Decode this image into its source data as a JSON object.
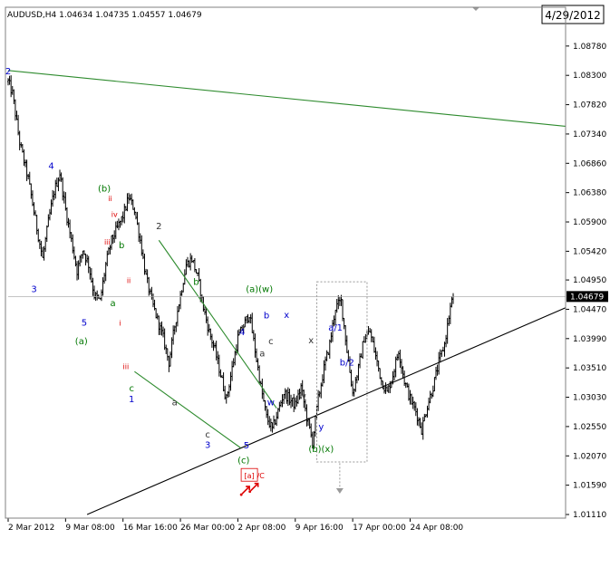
{
  "header": {
    "symbol_info": "AUDUSD,H4  1.04634 1.04735 1.04557 1.04679",
    "date_badge": "4/29/2012",
    "price_tag": "1.04679"
  },
  "colors": {
    "background": "#ffffff",
    "candles": "#000000",
    "frame": "#808080",
    "price_tag_bg": "#000000",
    "price_tag_text": "#ffffff",
    "green_lines": "#2e8b2e",
    "black_line": "#000000",
    "label_blue": "#0000cc",
    "label_green": "#007700",
    "label_red": "#dd0000",
    "label_dark": "#333333",
    "box_border": "#999999"
  },
  "chart_data": {
    "type": "candlestick",
    "title": "AUDUSD,H4",
    "ohlc_last": {
      "open": 1.04634,
      "high": 1.04735,
      "low": 1.04557,
      "close": 1.04679
    },
    "ylim": [
      1.0111,
      1.09
    ],
    "y_ticks": [
      "1.08780",
      "1.08300",
      "1.07820",
      "1.07340",
      "1.06860",
      "1.06380",
      "1.05900",
      "1.05420",
      "1.04950",
      "1.04470",
      "1.03990",
      "1.03510",
      "1.03030",
      "1.02550",
      "1.02070",
      "1.01590",
      "1.01110"
    ],
    "x_ticks": [
      "2 Mar 2012",
      "9 Mar 08:00",
      "16 Mar 16:00",
      "26 Mar 00:00",
      "2 Apr 08:00",
      "9 Apr 16:00",
      "17 Apr 00:00",
      "24 Apr 08:00"
    ],
    "x_tick_index": [
      0,
      40,
      80,
      120,
      160,
      200,
      240,
      280
    ],
    "bar_count": 310,
    "close_anchors": [
      [
        0,
        1.082
      ],
      [
        3,
        1.08
      ],
      [
        8,
        1.072
      ],
      [
        14,
        1.066
      ],
      [
        20,
        1.058
      ],
      [
        24,
        1.053
      ],
      [
        28,
        1.059
      ],
      [
        32,
        1.064
      ],
      [
        36,
        1.067
      ],
      [
        40,
        1.061
      ],
      [
        44,
        1.056
      ],
      [
        48,
        1.051
      ],
      [
        52,
        1.0545
      ],
      [
        56,
        1.052
      ],
      [
        60,
        1.047
      ],
      [
        64,
        1.046
      ],
      [
        68,
        1.052
      ],
      [
        72,
        1.056
      ],
      [
        76,
        1.058
      ],
      [
        80,
        1.06
      ],
      [
        84,
        1.063
      ],
      [
        88,
        1.061
      ],
      [
        92,
        1.056
      ],
      [
        96,
        1.05
      ],
      [
        100,
        1.046
      ],
      [
        104,
        1.043
      ],
      [
        108,
        1.04
      ],
      [
        112,
        1.036
      ],
      [
        116,
        1.042
      ],
      [
        120,
        1.047
      ],
      [
        124,
        1.052
      ],
      [
        128,
        1.053
      ],
      [
        132,
        1.05
      ],
      [
        136,
        1.045
      ],
      [
        140,
        1.041
      ],
      [
        144,
        1.038
      ],
      [
        148,
        1.034
      ],
      [
        152,
        1.03
      ],
      [
        156,
        1.035
      ],
      [
        160,
        1.04
      ],
      [
        164,
        1.042
      ],
      [
        168,
        1.044
      ],
      [
        172,
        1.038
      ],
      [
        176,
        1.032
      ],
      [
        180,
        1.027
      ],
      [
        184,
        1.025
      ],
      [
        188,
        1.028
      ],
      [
        192,
        1.031
      ],
      [
        196,
        1.03
      ],
      [
        200,
        1.029
      ],
      [
        204,
        1.032
      ],
      [
        208,
        1.027
      ],
      [
        212,
        1.023
      ],
      [
        216,
        1.03
      ],
      [
        220,
        1.035
      ],
      [
        224,
        1.039
      ],
      [
        228,
        1.045
      ],
      [
        232,
        1.046
      ],
      [
        236,
        1.038
      ],
      [
        240,
        1.031
      ],
      [
        244,
        1.035
      ],
      [
        248,
        1.04
      ],
      [
        252,
        1.041
      ],
      [
        256,
        1.037
      ],
      [
        260,
        1.033
      ],
      [
        264,
        1.031
      ],
      [
        268,
        1.034
      ],
      [
        272,
        1.038
      ],
      [
        276,
        1.033
      ],
      [
        280,
        1.03
      ],
      [
        284,
        1.028
      ],
      [
        288,
        1.025
      ],
      [
        292,
        1.029
      ],
      [
        296,
        1.032
      ],
      [
        300,
        1.036
      ],
      [
        304,
        1.039
      ],
      [
        308,
        1.045
      ],
      [
        310,
        1.0468
      ]
    ],
    "trendlines": [
      {
        "name": "upper-green-line",
        "color": "green",
        "from": [
          0,
          1.0838
        ],
        "to": [
          310,
          1.0765
        ]
      },
      {
        "name": "lower-black-line",
        "color": "black",
        "from": [
          55,
          1.0111
        ],
        "to": [
          310,
          1.037
        ]
      },
      {
        "name": "channel-upper-line",
        "color": "green",
        "from": [
          105,
          1.056
        ],
        "to": [
          187,
          1.0285
        ]
      },
      {
        "name": "channel-lower-line",
        "color": "green",
        "from": [
          88,
          1.0345
        ],
        "to": [
          162,
          1.022
        ]
      },
      {
        "name": "current-price-line",
        "color": "gray",
        "from": [
          0,
          1.04679
        ],
        "to": [
          310,
          1.04679
        ]
      }
    ],
    "box": {
      "from": [
        215,
        1.0492
      ],
      "to": [
        250,
        1.0197
      ]
    },
    "projection_arrow": {
      "from": [
        231,
        1.0195
      ],
      "to": [
        231,
        1.0148
      ]
    },
    "annotations": [
      {
        "text": "2",
        "at": [
          0,
          1.0832
        ],
        "color": "blue"
      },
      {
        "text": "4",
        "at": [
          30,
          1.0677
        ],
        "color": "blue"
      },
      {
        "text": "3",
        "at": [
          18,
          1.0475
        ],
        "color": "blue"
      },
      {
        "text": "5",
        "at": [
          53,
          1.042
        ],
        "color": "blue"
      },
      {
        "text": "(a)",
        "at": [
          51,
          1.039
        ],
        "color": "green"
      },
      {
        "text": "(b)",
        "at": [
          67,
          1.064
        ],
        "color": "green"
      },
      {
        "text": "ii",
        "at": [
          71,
          1.0624
        ],
        "color": "red"
      },
      {
        "text": "iv",
        "at": [
          74,
          1.0598
        ],
        "color": "red"
      },
      {
        "text": "iii",
        "at": [
          69,
          1.0553
        ],
        "color": "red"
      },
      {
        "text": "b",
        "at": [
          79,
          1.0547
        ],
        "color": "green"
      },
      {
        "text": "a",
        "at": [
          73,
          1.0452
        ],
        "color": "green"
      },
      {
        "text": "ii",
        "at": [
          84,
          1.049
        ],
        "color": "red"
      },
      {
        "text": "i",
        "at": [
          78,
          1.042
        ],
        "color": "red"
      },
      {
        "text": "iii",
        "at": [
          82,
          1.0349
        ],
        "color": "red"
      },
      {
        "text": "c",
        "at": [
          86,
          1.0313
        ],
        "color": "green"
      },
      {
        "text": "1",
        "at": [
          86,
          1.0295
        ],
        "color": "blue"
      },
      {
        "text": "2",
        "at": [
          105,
          1.0578
        ],
        "color": "dark"
      },
      {
        "text": "a",
        "at": [
          116,
          1.029
        ],
        "color": "dark"
      },
      {
        "text": "b",
        "at": [
          131,
          1.0487
        ],
        "color": "green"
      },
      {
        "text": "c",
        "at": [
          139,
          1.0237
        ],
        "color": "dark"
      },
      {
        "text": "3",
        "at": [
          139,
          1.022
        ],
        "color": "blue"
      },
      {
        "text": "4",
        "at": [
          163,
          1.0405
        ],
        "color": "blue"
      },
      {
        "text": "5",
        "at": [
          166,
          1.0219
        ],
        "color": "blue"
      },
      {
        "text": "(c)",
        "at": [
          164,
          1.0195
        ],
        "color": "green"
      },
      {
        "text": "[a]",
        "at": [
          168,
          1.017
        ],
        "color": "red"
      },
      {
        "text": "/C",
        "at": [
          176,
          1.017
        ],
        "color": "red"
      },
      {
        "text": "(a)(w)",
        "at": [
          175,
          1.0475
        ],
        "color": "green"
      },
      {
        "text": "b",
        "at": [
          180,
          1.0432
        ],
        "color": "blue"
      },
      {
        "text": "a",
        "at": [
          177,
          1.037
        ],
        "color": "dark"
      },
      {
        "text": "c",
        "at": [
          183,
          1.039
        ],
        "color": "dark"
      },
      {
        "text": "w",
        "at": [
          183,
          1.029
        ],
        "color": "blue"
      },
      {
        "text": "x",
        "at": [
          194,
          1.0433
        ],
        "color": "blue"
      },
      {
        "text": "w",
        "at": [
          205,
          1.03
        ],
        "color": "dark"
      },
      {
        "text": "x",
        "at": [
          211,
          1.0391
        ],
        "color": "dark"
      },
      {
        "text": "y",
        "at": [
          218,
          1.025
        ],
        "color": "blue"
      },
      {
        "text": "(b)(x)",
        "at": [
          218,
          1.0213
        ],
        "color": "green"
      },
      {
        "text": "a/1",
        "at": [
          228,
          1.0412
        ],
        "color": "blue"
      },
      {
        "text": "b/2",
        "at": [
          236,
          1.0355
        ],
        "color": "blue"
      }
    ]
  }
}
